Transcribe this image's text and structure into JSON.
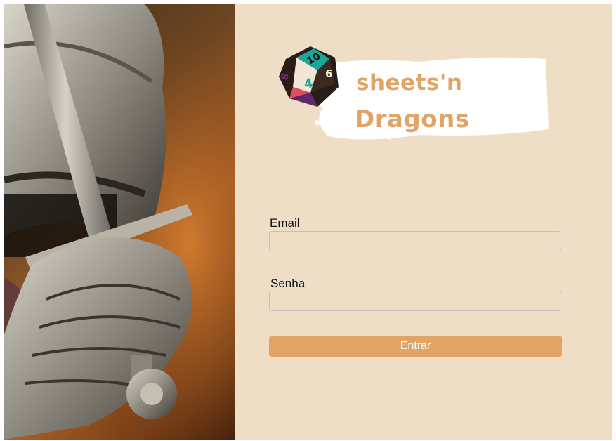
{
  "brand": {
    "name_line1": "sheets'n",
    "name_line2": "Dragons",
    "die_numbers": [
      "10",
      "6",
      "8",
      "4"
    ],
    "accent_color": "#e2a466",
    "teal_color": "#1aa89a"
  },
  "form": {
    "email_label": "Email",
    "email_value": "",
    "password_label": "Senha",
    "password_value": "",
    "submit_label": "Entrar"
  },
  "hero": {
    "icon": "knight-armor-sword-image"
  }
}
